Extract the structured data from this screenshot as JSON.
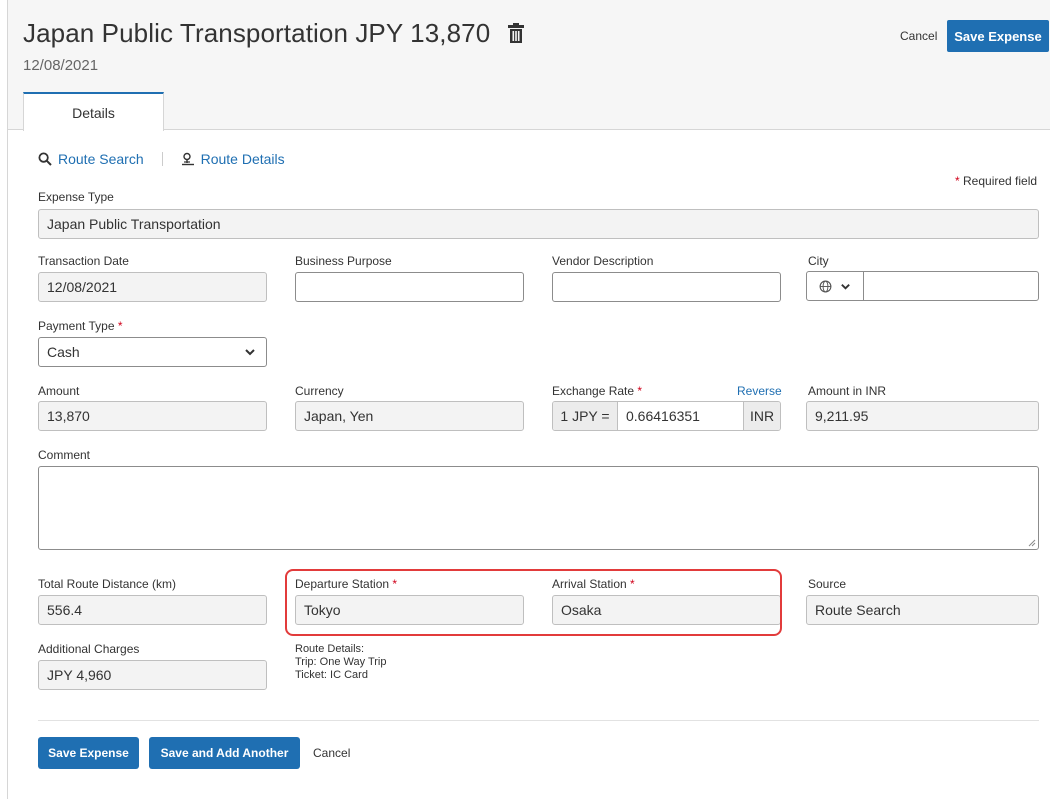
{
  "header": {
    "title": "Japan Public Transportation JPY 13,870",
    "date": "12/08/2021",
    "cancel_label": "Cancel",
    "save_label": "Save Expense"
  },
  "tabs": [
    {
      "label": "Details"
    }
  ],
  "links": {
    "route_search": "Route Search",
    "route_details": "Route Details"
  },
  "required_note": "Required field",
  "form": {
    "expense_type": {
      "label": "Expense Type",
      "value": "Japan Public Transportation"
    },
    "transaction_date": {
      "label": "Transaction Date",
      "value": "12/08/2021"
    },
    "business_purpose": {
      "label": "Business Purpose",
      "value": ""
    },
    "vendor_description": {
      "label": "Vendor Description",
      "value": ""
    },
    "city": {
      "label": "City",
      "value": ""
    },
    "payment_type": {
      "label": "Payment Type",
      "value": "Cash"
    },
    "amount": {
      "label": "Amount",
      "value": "13,870"
    },
    "currency": {
      "label": "Currency",
      "value": "Japan, Yen"
    },
    "exchange_rate": {
      "label": "Exchange Rate",
      "reverse_label": "Reverse",
      "prefix": "1 JPY =",
      "value": "0.66416351",
      "suffix": "INR"
    },
    "amount_in_inr": {
      "label": "Amount in INR",
      "value": "9,211.95"
    },
    "comment": {
      "label": "Comment",
      "value": ""
    },
    "total_route_distance": {
      "label": "Total Route Distance (km)",
      "value": "556.4"
    },
    "departure_station": {
      "label": "Departure Station",
      "value": "Tokyo"
    },
    "arrival_station": {
      "label": "Arrival Station",
      "value": "Osaka"
    },
    "source": {
      "label": "Source",
      "value": "Route Search"
    },
    "additional_charges": {
      "label": "Additional Charges",
      "value": "JPY 4,960"
    },
    "route_details": {
      "heading": "Route Details:",
      "trip": "Trip: One Way Trip",
      "ticket": "Ticket: IC Card"
    }
  },
  "footer": {
    "save_label": "Save Expense",
    "save_add_label": "Save and Add Another",
    "cancel_label": "Cancel"
  },
  "colors": {
    "accent": "#1f6fb2",
    "required": "#d0021b",
    "highlight": "#e23b3b"
  },
  "icons": [
    "trash-icon",
    "search-icon",
    "route-details-icon",
    "globe-icon",
    "chevron-down-icon"
  ]
}
